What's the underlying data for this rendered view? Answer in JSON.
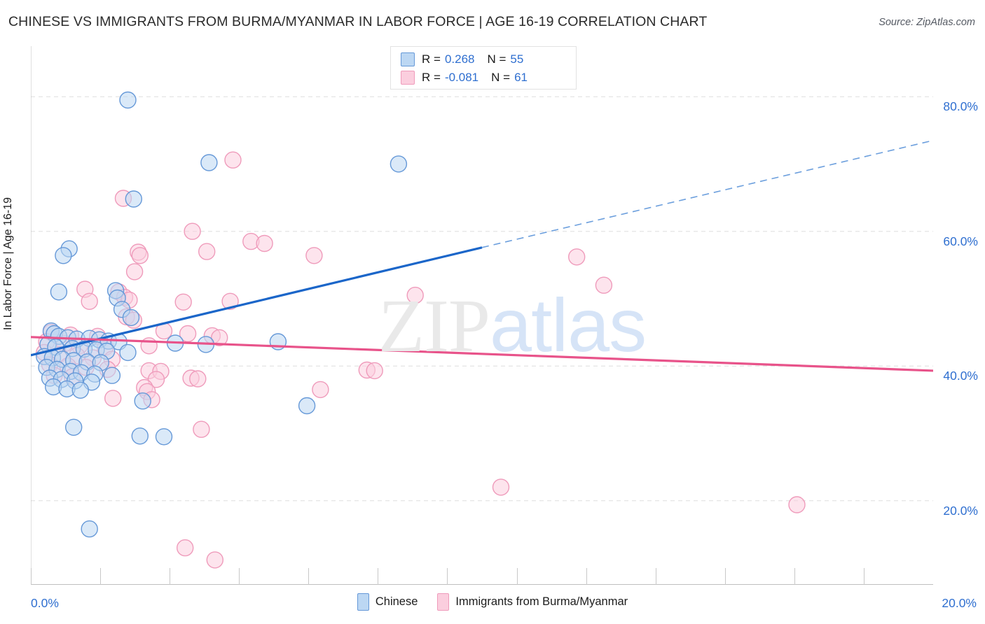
{
  "header": {
    "title": "CHINESE VS IMMIGRANTS FROM BURMA/MYANMAR IN LABOR FORCE | AGE 16-19 CORRELATION CHART",
    "source": "Source: ZipAtlas.com"
  },
  "watermark": {
    "part1": "ZIP",
    "part2": "atlas"
  },
  "stats_legend": {
    "rows": [
      {
        "color": "#6699d8",
        "r_label": "R =",
        "r_value": "0.268",
        "n_label": "N =",
        "n_value": "55"
      },
      {
        "color": "#ef9bbb",
        "r_label": "R =",
        "r_value": "-0.081",
        "n_label": "N =",
        "n_value": "61"
      }
    ]
  },
  "series_legend": {
    "entries": [
      {
        "label": "Chinese",
        "color": "#bcd7f3"
      },
      {
        "label": "Immigrants from Burma/Myanmar",
        "color": "#fbcede"
      }
    ]
  },
  "chart_data": {
    "type": "scatter",
    "title": "CHINESE VS IMMIGRANTS FROM BURMA/MYANMAR IN LABOR FORCE | AGE 16-19 CORRELATION CHART",
    "xlabel": "",
    "ylabel": "In Labor Force | Age 16-19",
    "xlim": [
      0.0,
      20.0
    ],
    "ylim": [
      7.5,
      87.5
    ],
    "x_tick_labels": [
      "0.0%",
      "20.0%"
    ],
    "y_tick_labels": [
      "80.0%",
      "60.0%",
      "40.0%",
      "20.0%"
    ],
    "y_ticks": [
      80.0,
      60.0,
      40.0,
      20.0
    ],
    "grid": true,
    "legend_position": "bottom-center",
    "series": [
      {
        "name": "Chinese",
        "color": "#6699d8",
        "fill": "#bcd7f3",
        "r": 0.268,
        "n": 55,
        "trend": {
          "x0": 0.0,
          "y0": 41.6,
          "x1": 10.0,
          "y1": 57.6,
          "solid_to_x": 10.0,
          "dash_to_x": 20.0,
          "dash_y1": 73.5
        },
        "points": [
          [
            2.15,
            79.5
          ],
          [
            3.95,
            70.2
          ],
          [
            8.15,
            70.0
          ],
          [
            2.28,
            64.8
          ],
          [
            0.85,
            57.4
          ],
          [
            0.72,
            56.4
          ],
          [
            0.62,
            51.0
          ],
          [
            1.88,
            51.2
          ],
          [
            1.92,
            50.1
          ],
          [
            2.02,
            48.4
          ],
          [
            2.22,
            47.2
          ],
          [
            0.45,
            45.2
          ],
          [
            0.52,
            44.8
          ],
          [
            0.62,
            44.4
          ],
          [
            0.82,
            44.2
          ],
          [
            1.02,
            44.0
          ],
          [
            1.3,
            44.1
          ],
          [
            1.52,
            43.9
          ],
          [
            1.72,
            43.7
          ],
          [
            1.95,
            43.6
          ],
          [
            0.38,
            43.2
          ],
          [
            0.55,
            42.8
          ],
          [
            0.92,
            42.6
          ],
          [
            1.18,
            42.5
          ],
          [
            1.45,
            42.4
          ],
          [
            1.68,
            42.2
          ],
          [
            2.15,
            42.0
          ],
          [
            3.2,
            43.4
          ],
          [
            3.88,
            43.2
          ],
          [
            5.48,
            43.6
          ],
          [
            0.3,
            41.4
          ],
          [
            0.48,
            41.2
          ],
          [
            0.7,
            41.0
          ],
          [
            0.95,
            40.8
          ],
          [
            1.25,
            40.6
          ],
          [
            1.55,
            40.5
          ],
          [
            0.35,
            39.8
          ],
          [
            0.58,
            39.5
          ],
          [
            0.88,
            39.2
          ],
          [
            1.12,
            39.0
          ],
          [
            1.42,
            38.8
          ],
          [
            1.8,
            38.6
          ],
          [
            0.42,
            38.2
          ],
          [
            0.68,
            38.0
          ],
          [
            0.98,
            37.8
          ],
          [
            1.35,
            37.6
          ],
          [
            0.5,
            36.9
          ],
          [
            0.8,
            36.6
          ],
          [
            1.1,
            36.4
          ],
          [
            2.48,
            34.8
          ],
          [
            6.12,
            34.1
          ],
          [
            0.95,
            30.9
          ],
          [
            2.42,
            29.6
          ],
          [
            2.95,
            29.5
          ],
          [
            1.3,
            15.8
          ]
        ]
      },
      {
        "name": "Immigrants from Burma/Myanmar",
        "color": "#ef9bbb",
        "fill": "#fbcede",
        "r": -0.081,
        "n": 61,
        "trend": {
          "x0": 0.0,
          "y0": 44.3,
          "x1": 20.0,
          "y1": 39.3
        },
        "points": [
          [
            4.48,
            70.6
          ],
          [
            2.05,
            64.9
          ],
          [
            3.58,
            60.0
          ],
          [
            4.88,
            58.5
          ],
          [
            5.18,
            58.2
          ],
          [
            2.38,
            56.9
          ],
          [
            2.42,
            56.4
          ],
          [
            3.9,
            57.0
          ],
          [
            6.28,
            56.4
          ],
          [
            12.1,
            56.2
          ],
          [
            2.3,
            54.0
          ],
          [
            1.2,
            51.4
          ],
          [
            1.95,
            51.0
          ],
          [
            2.08,
            50.2
          ],
          [
            2.18,
            49.8
          ],
          [
            12.7,
            52.0
          ],
          [
            8.52,
            50.5
          ],
          [
            1.3,
            49.6
          ],
          [
            3.38,
            49.5
          ],
          [
            4.42,
            49.6
          ],
          [
            2.12,
            47.3
          ],
          [
            2.28,
            46.8
          ],
          [
            2.95,
            45.2
          ],
          [
            3.48,
            44.8
          ],
          [
            0.45,
            45.0
          ],
          [
            0.88,
            44.6
          ],
          [
            1.48,
            44.4
          ],
          [
            4.02,
            44.5
          ],
          [
            4.18,
            44.2
          ],
          [
            0.35,
            43.6
          ],
          [
            0.75,
            43.3
          ],
          [
            1.08,
            43.0
          ],
          [
            1.65,
            42.8
          ],
          [
            2.62,
            43.0
          ],
          [
            0.3,
            42.0
          ],
          [
            0.62,
            41.7
          ],
          [
            1.02,
            41.5
          ],
          [
            1.38,
            41.2
          ],
          [
            1.8,
            41.0
          ],
          [
            0.42,
            40.2
          ],
          [
            0.82,
            40.0
          ],
          [
            1.22,
            39.8
          ],
          [
            1.7,
            39.5
          ],
          [
            2.62,
            39.3
          ],
          [
            2.88,
            39.2
          ],
          [
            7.45,
            39.4
          ],
          [
            7.62,
            39.3
          ],
          [
            0.52,
            38.6
          ],
          [
            0.92,
            38.4
          ],
          [
            2.78,
            38.0
          ],
          [
            3.55,
            38.2
          ],
          [
            3.7,
            38.1
          ],
          [
            2.52,
            36.8
          ],
          [
            2.58,
            36.2
          ],
          [
            6.42,
            36.5
          ],
          [
            1.82,
            35.2
          ],
          [
            2.68,
            35.0
          ],
          [
            3.78,
            30.6
          ],
          [
            10.42,
            22.0
          ],
          [
            16.98,
            19.4
          ],
          [
            3.42,
            13.0
          ]
        ]
      }
    ],
    "extra_points": [
      {
        "series": "Immigrants from Burma/Myanmar",
        "x": 4.08,
        "y": 11.2
      }
    ]
  }
}
